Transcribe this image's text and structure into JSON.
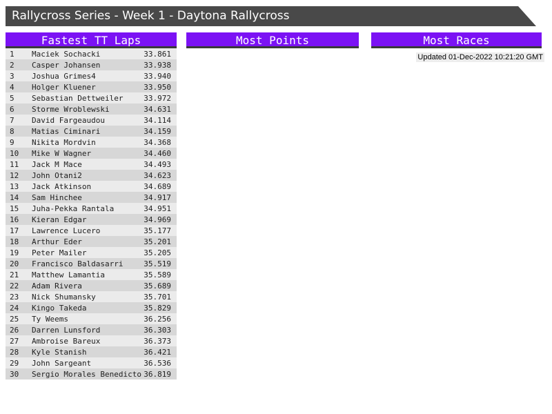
{
  "title_bar": {
    "title": "Rallycross Series - Week 1 - Daytona Rallycross"
  },
  "columns": [
    {
      "id": "fastest_tt_laps",
      "header": "Fastest TT Laps",
      "rows": [
        {
          "rank": "1",
          "name": "Maciek Sochacki",
          "time": "33.861"
        },
        {
          "rank": "2",
          "name": "Casper Johansen",
          "time": "33.938"
        },
        {
          "rank": "3",
          "name": "Joshua Grimes4",
          "time": "33.940"
        },
        {
          "rank": "4",
          "name": "Holger Kluener",
          "time": "33.950"
        },
        {
          "rank": "5",
          "name": "Sebastian Dettweiler",
          "time": "33.972"
        },
        {
          "rank": "6",
          "name": "Storme Wroblewski",
          "time": "34.631"
        },
        {
          "rank": "7",
          "name": "David Fargeaudou",
          "time": "34.114"
        },
        {
          "rank": "8",
          "name": "Matias Ciminari",
          "time": "34.159"
        },
        {
          "rank": "9",
          "name": "Nikita Mordvin",
          "time": "34.368"
        },
        {
          "rank": "10",
          "name": "Mike W Wagner",
          "time": "34.460"
        },
        {
          "rank": "11",
          "name": "Jack M Mace",
          "time": "34.493"
        },
        {
          "rank": "12",
          "name": "John Otani2",
          "time": "34.623"
        },
        {
          "rank": "13",
          "name": "Jack Atkinson",
          "time": "34.689"
        },
        {
          "rank": "14",
          "name": "Sam Hinchee",
          "time": "34.917"
        },
        {
          "rank": "15",
          "name": "Juha-Pekka Rantala",
          "time": "34.951"
        },
        {
          "rank": "16",
          "name": "Kieran Edgar",
          "time": "34.969"
        },
        {
          "rank": "17",
          "name": "Lawrence Lucero",
          "time": "35.177"
        },
        {
          "rank": "18",
          "name": "Arthur Eder",
          "time": "35.201"
        },
        {
          "rank": "19",
          "name": "Peter Mailer",
          "time": "35.205"
        },
        {
          "rank": "20",
          "name": "Francisco Baldasarri",
          "time": "35.519"
        },
        {
          "rank": "21",
          "name": "Matthew Lamantia",
          "time": "35.589"
        },
        {
          "rank": "22",
          "name": "Adam Rivera",
          "time": "35.689"
        },
        {
          "rank": "23",
          "name": "Nick Shumansky",
          "time": "35.701"
        },
        {
          "rank": "24",
          "name": "Kingo Takeda",
          "time": "35.829"
        },
        {
          "rank": "25",
          "name": "Ty Weems",
          "time": "36.256"
        },
        {
          "rank": "26",
          "name": "Darren Lunsford",
          "time": "36.303"
        },
        {
          "rank": "27",
          "name": "Ambroise Bareux",
          "time": "36.373"
        },
        {
          "rank": "28",
          "name": "Kyle Stanish",
          "time": "36.421"
        },
        {
          "rank": "29",
          "name": "John Sargeant",
          "time": "36.536"
        },
        {
          "rank": "30",
          "name": "Sergio Morales Benedicto",
          "time": "36.819"
        }
      ]
    },
    {
      "id": "most_points",
      "header": "Most Points",
      "rows": []
    },
    {
      "id": "most_races",
      "header": "Most Races",
      "rows": []
    }
  ],
  "status": {
    "updated": "Updated 01-Dec-2022 10:21:20 GMT"
  },
  "colors": {
    "accent": "#7b12f4",
    "titlebar": "#494949",
    "header_border": "#3a3a3a",
    "row_odd": "#ebebeb",
    "row_even": "#d7d7d7"
  }
}
